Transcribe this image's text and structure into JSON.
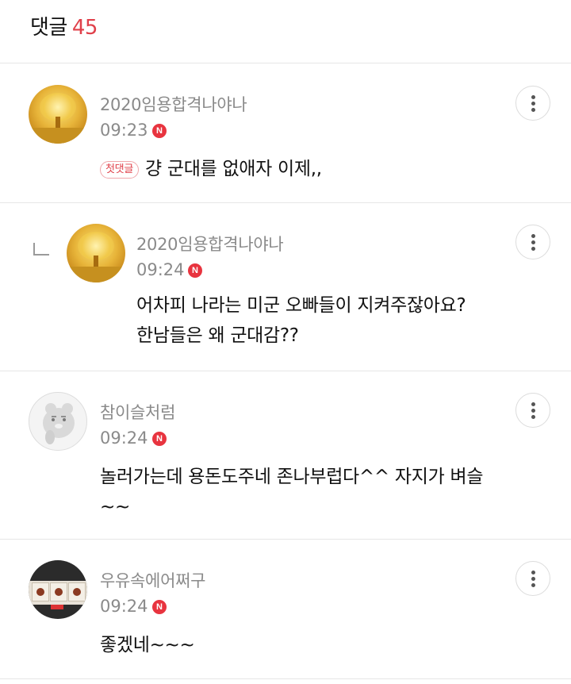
{
  "header": {
    "title": "댓글",
    "count": "45"
  },
  "comments": [
    {
      "username": "2020임용합격나야나",
      "time": "09:23",
      "new_badge": "N",
      "first_badge": "첫댓글",
      "text_lines": [
        "걍 군대를 없애자 이제,,"
      ],
      "avatar": "golden-tree"
    },
    {
      "username": "2020임용합격나야나",
      "time": "09:24",
      "new_badge": "N",
      "is_reply": true,
      "text_lines": [
        "어차피 나라는 미군 오빠들이 지켜주잖아요?",
        "한남들은 왜 군대감??"
      ],
      "avatar": "golden-tree"
    },
    {
      "username": "참이슬처럼",
      "time": "09:24",
      "new_badge": "N",
      "text_lines": [
        "놀러가는데 용돈도주네 존나부럽다^^ 자지가 벼슬",
        "~~"
      ],
      "avatar": "ryan-character"
    },
    {
      "username": "우유속에어쩌구",
      "time": "09:24",
      "new_badge": "N",
      "text_lines": [
        "좋겠네~~~"
      ],
      "avatar": "store-shelf-photo"
    }
  ],
  "icons": {
    "more": "more-vertical-icon",
    "reply": "reply-arrow-icon",
    "new": "new-badge"
  },
  "colors": {
    "accent": "#e0404a",
    "badge": "#e8343f",
    "muted": "#8a8a8a"
  }
}
